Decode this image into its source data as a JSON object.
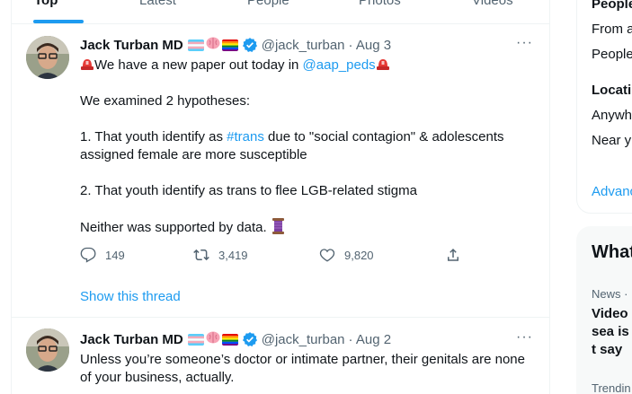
{
  "tabs": [
    {
      "label": "Top",
      "active": true
    },
    {
      "label": "Latest",
      "active": false
    },
    {
      "label": "People",
      "active": false
    },
    {
      "label": "Photos",
      "active": false
    },
    {
      "label": "Videos",
      "active": false
    }
  ],
  "tweets": [
    {
      "author": "Jack Turban MD",
      "handle": "@jack_turban",
      "date": "· Aug 3",
      "emoji_icons": [
        "transgender-flag-icon",
        "brain-icon",
        "rainbow-flag-icon",
        "verified-badge-icon"
      ],
      "lines": {
        "l1_pre": "We have a new paper out today in ",
        "l1_link": "@aap_peds",
        "l2": "We examined 2 hypotheses:",
        "l3_pre": "1. That youth identify as ",
        "l3_link": "#trans",
        "l3_post": " due to \"social contagion\" & adolescents assigned female are more susceptible",
        "l4": "2. That youth identify as trans to flee LGB-related stigma",
        "l5": "Neither was supported by data. "
      },
      "actions": {
        "replies": "149",
        "retweets": "3,419",
        "likes": "9,820"
      },
      "show_thread": "Show this thread"
    },
    {
      "author": "Jack Turban MD",
      "handle": "@jack_turban",
      "date": "· Aug 2",
      "text": "Unless you’re someone’s doctor or intimate partner, their genitals are none of your business, actually."
    }
  ],
  "sidebar": {
    "people_heading": "People",
    "people_opt1": "From a",
    "people_opt2": "People",
    "location_heading": "Locati",
    "location_opt1": "Anywh",
    "location_opt2": "Near y",
    "advanced": "Advanc",
    "whats_heading": "What",
    "news_label": "News ·",
    "news_headline": "Video sea is t say",
    "trending_label": "Trendin"
  },
  "colors": {
    "accent": "#1d9bf0",
    "text": "#0f1419",
    "secondary": "#536471",
    "border": "#eff3f4"
  }
}
